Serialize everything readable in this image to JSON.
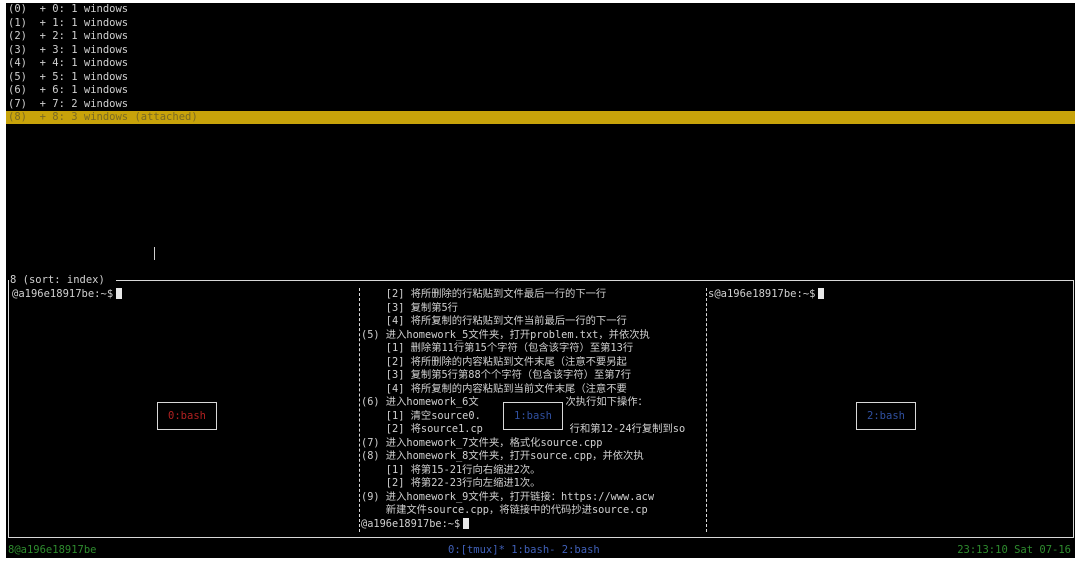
{
  "sessions": [
    {
      "idx": "(0)",
      "text": "+ 0: 1 windows"
    },
    {
      "idx": "(1)",
      "text": "+ 1: 1 windows"
    },
    {
      "idx": "(2)",
      "text": "+ 2: 1 windows"
    },
    {
      "idx": "(3)",
      "text": "+ 3: 1 windows"
    },
    {
      "idx": "(4)",
      "text": "+ 4: 1 windows"
    },
    {
      "idx": "(5)",
      "text": "+ 5: 1 windows"
    },
    {
      "idx": "(6)",
      "text": "+ 6: 1 windows"
    },
    {
      "idx": "(7)",
      "text": "+ 7: 2 windows"
    },
    {
      "idx": "(8)",
      "text": "+ 8: 3 windows (attached)"
    }
  ],
  "preview": {
    "title": "8 (sort: index)",
    "left_prompt": "@a196e18917be:~$",
    "right_prompt": "s@a196e18917be:~$",
    "mid_lines": [
      "    [2] 将所删除的行粘贴到文件最后一行的下一行",
      "    [3] 复制第5行",
      "    [4] 将所复制的行粘贴到文件当前最后一行的下一行",
      "(5) 进入homework_5文件夹，打开problem.txt，并依次执",
      "    [1] 删除第11行第15个字符（包含该字符）至第13行",
      "    [2] 将所删除的内容粘贴到文件末尾（注意不要另起",
      "    [3] 复制第5行第88个个字符（包含该字符）至第7行",
      "    [4] 将所复制的内容粘贴到当前文件末尾（注意不要",
      "(6) 进入homework_6文              次执行如下操作：",
      "    [1] 清空source0.",
      "    [2] 将source1.cp              行和第12-24行复制到so",
      "(7) 进入homework_7文件夹，格式化source.cpp",
      "(8) 进入homework_8文件夹，打开source.cpp，并依次执",
      "    [1] 将第15-21行向右缩进2次。",
      "    [2] 将第22-23行向左缩进1次。",
      "(9) 进入homework_9文件夹，打开链接：https://www.acw",
      "    新建文件source.cpp，将链接中的代码抄进source.cp",
      "@a196e18917be:~$"
    ],
    "pane_labels": [
      "0:bash",
      "1:bash",
      "2:bash"
    ]
  },
  "status": {
    "left": "8@a196e18917be",
    "windows": "0:[tmux]* 1:bash- 2:bash",
    "right": "23:13:10 Sat 07-16"
  }
}
